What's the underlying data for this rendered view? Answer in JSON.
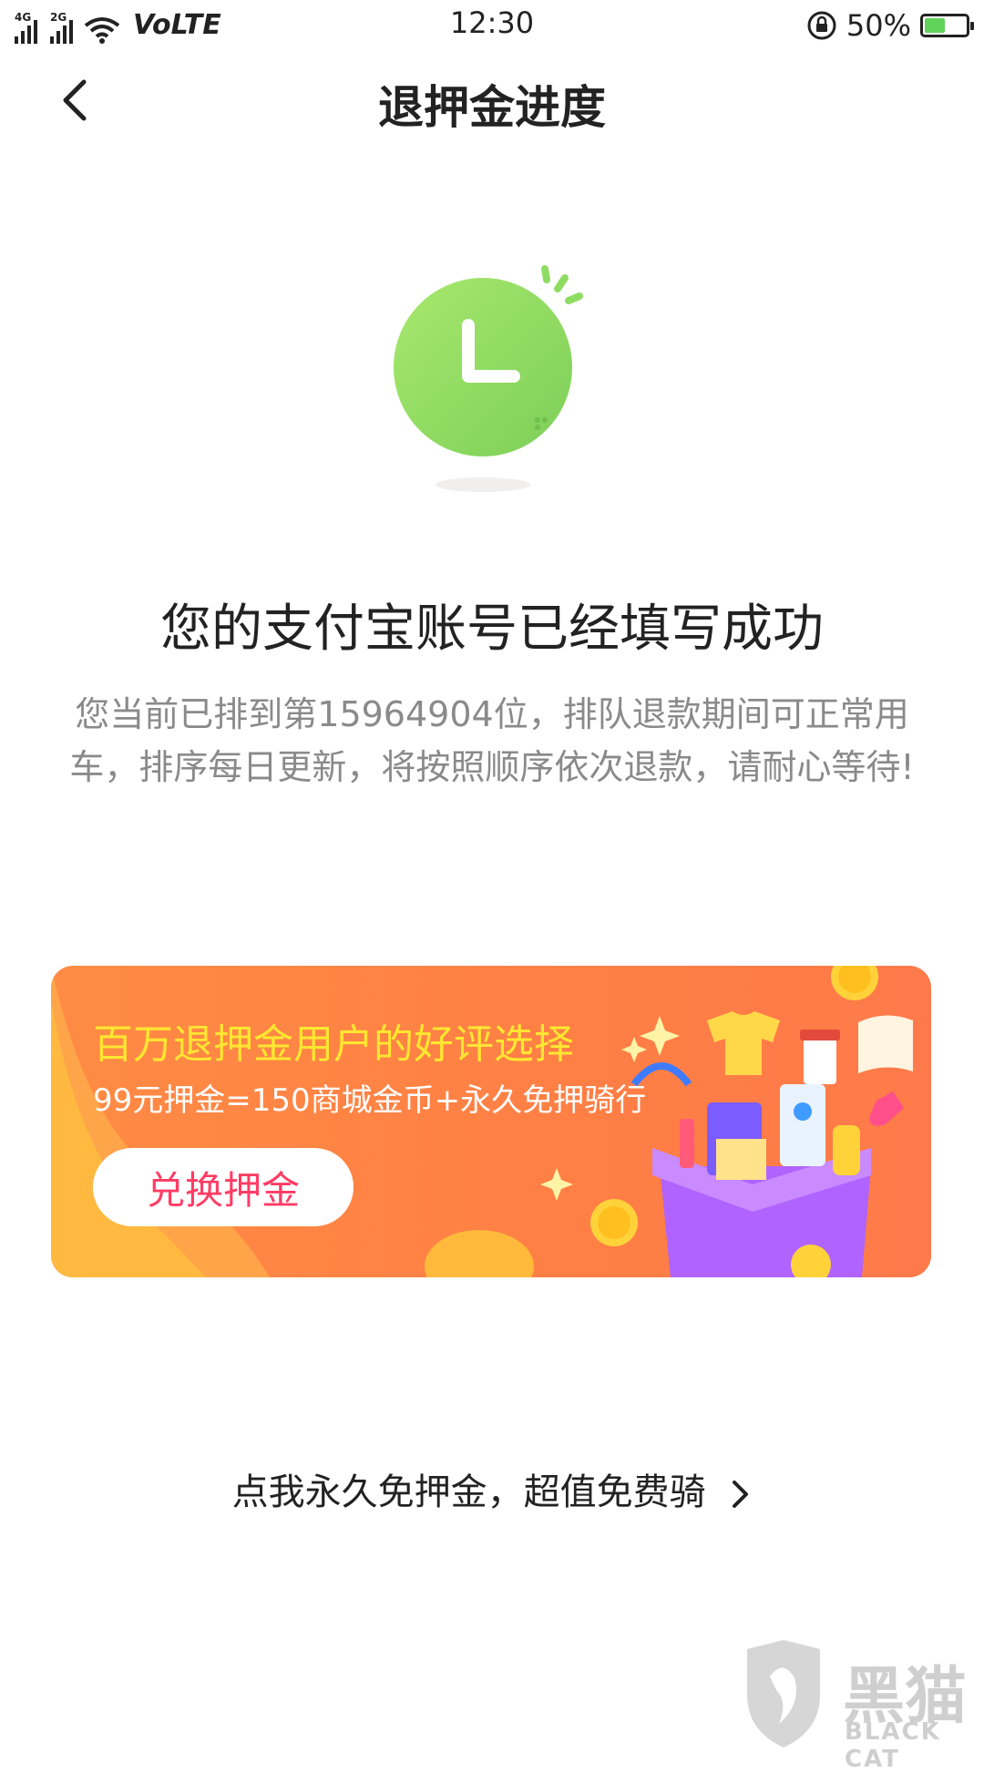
{
  "status_bar": {
    "net1": "4G",
    "net2": "2G",
    "volte": "VoLTE",
    "time": "12:30",
    "battery_pct": "50%",
    "battery_level": 0.5
  },
  "header": {
    "title": "退押金进度"
  },
  "main": {
    "success_title": "您的支付宝账号已经填写成功",
    "queue_text": "您当前已排到第15964904位，排队退款期间可正常用车，排序每日更新，将按照顺序依次退款，请耐心等待!"
  },
  "banner": {
    "title": "百万退押金用户的好评选择",
    "subtitle": "99元押金=150商城金币+永久免押骑行",
    "button_label": "兑换押金"
  },
  "footer_link": {
    "label": "点我永久免押金，超值免费骑"
  },
  "watermark": {
    "text": "黑猫",
    "sub": "BLACK CAT"
  },
  "colors": {
    "clock_green": "#8fdc63",
    "banner_orange": "#ff8a47",
    "banner_title": "#ffe631",
    "button_text": "#ff3c64"
  }
}
